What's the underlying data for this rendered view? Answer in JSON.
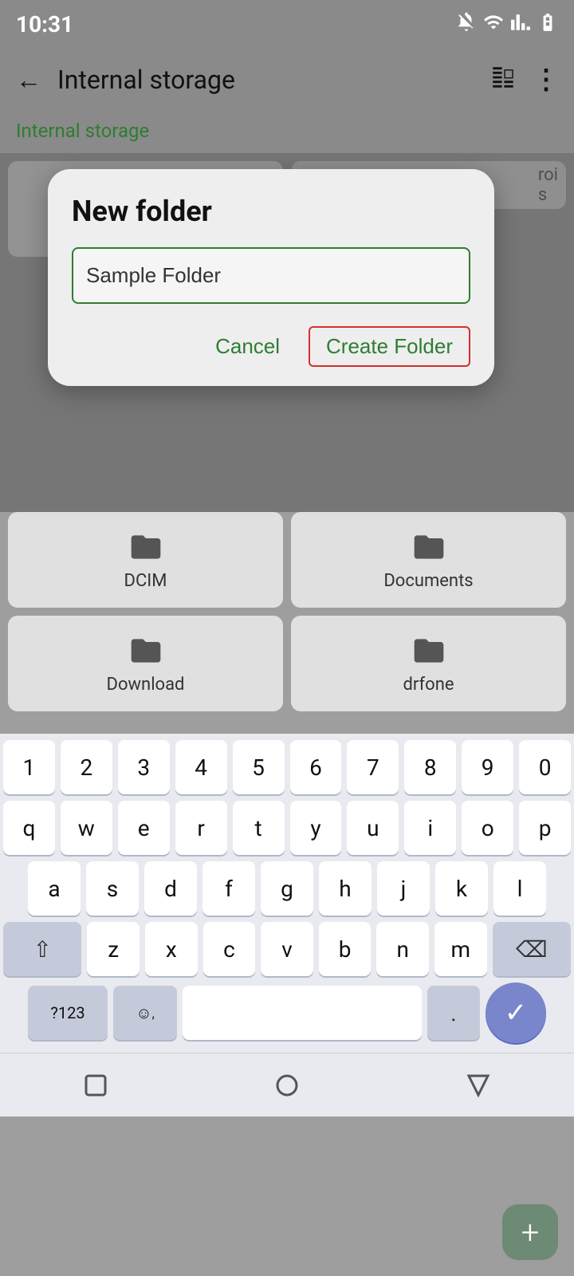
{
  "status": {
    "time": "10:31"
  },
  "app_bar": {
    "title": "Internal storage",
    "back_label": "back",
    "grid_label": "grid view",
    "more_label": "more options"
  },
  "breadcrumb": {
    "text": "Internal storage"
  },
  "dialog": {
    "title": "New folder",
    "input_value": "Sample Folder",
    "cancel_label": "Cancel",
    "create_label": "Create Folder"
  },
  "files": [
    {
      "name": "DCIM"
    },
    {
      "name": "Documents"
    },
    {
      "name": "Download"
    },
    {
      "name": "drfone"
    }
  ],
  "keyboard": {
    "rows": [
      [
        "1",
        "2",
        "3",
        "4",
        "5",
        "6",
        "7",
        "8",
        "9",
        "0"
      ],
      [
        "q",
        "w",
        "e",
        "r",
        "t",
        "y",
        "u",
        "i",
        "o",
        "p"
      ],
      [
        "a",
        "s",
        "d",
        "f",
        "g",
        "h",
        "j",
        "k",
        "l"
      ],
      [
        "z",
        "x",
        "c",
        "v",
        "b",
        "n",
        "m"
      ],
      [
        "?123",
        "☺",
        "space",
        ".",
        "✓"
      ]
    ]
  },
  "fab": {
    "label": "+"
  },
  "nav": {
    "square_label": "recent apps",
    "circle_label": "home",
    "triangle_label": "back"
  }
}
